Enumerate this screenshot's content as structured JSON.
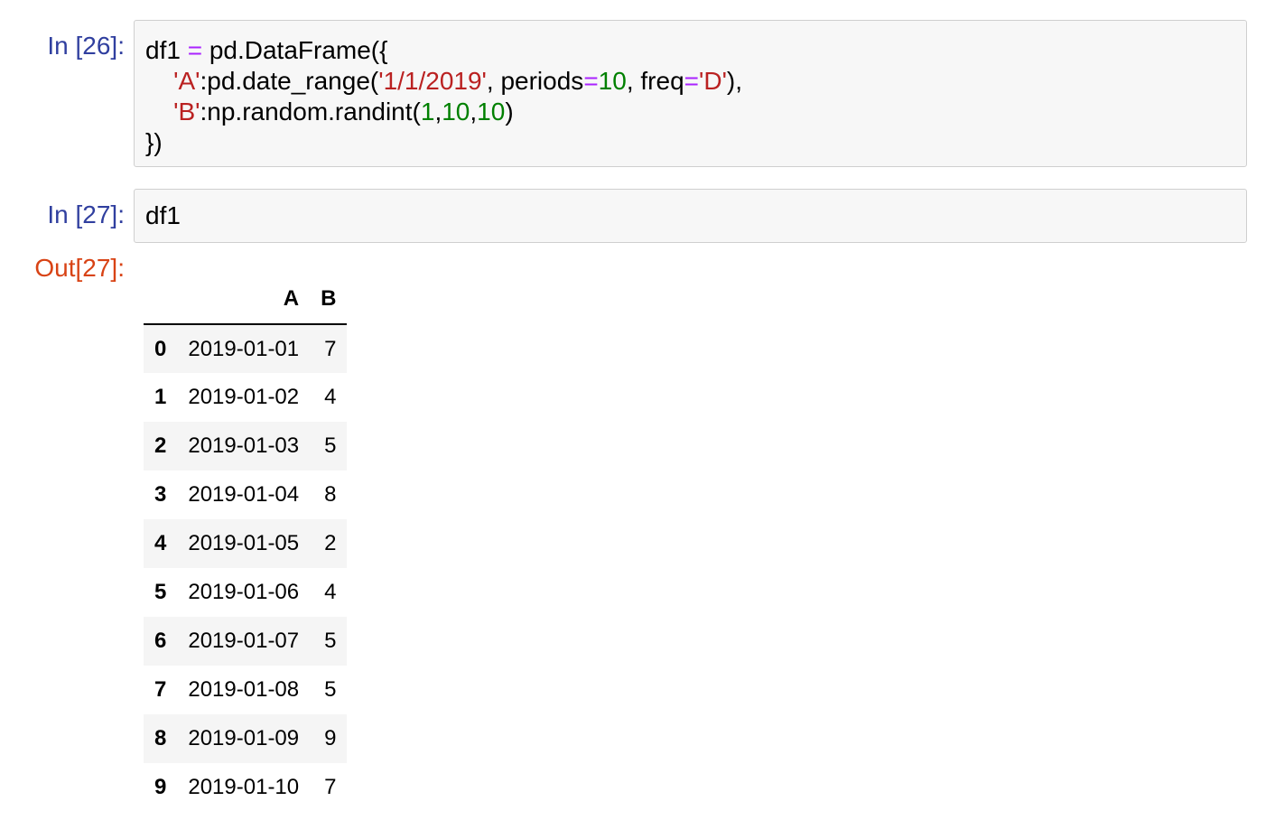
{
  "cells": {
    "cell26": {
      "prompt": "In [26]:",
      "code_lines": [
        [
          [
            "t",
            "df1 "
          ],
          [
            "o",
            "="
          ],
          [
            "t",
            " pd.DataFrame({"
          ]
        ],
        [
          [
            "t",
            "    "
          ],
          [
            "s",
            "'A'"
          ],
          [
            "t",
            ":pd.date_range("
          ],
          [
            "s",
            "'1/1/2019'"
          ],
          [
            "t",
            ", periods"
          ],
          [
            "o",
            "="
          ],
          [
            "n",
            "10"
          ],
          [
            "t",
            ", freq"
          ],
          [
            "o",
            "="
          ],
          [
            "s",
            "'D'"
          ],
          [
            "t",
            "),"
          ]
        ],
        [
          [
            "t",
            "    "
          ],
          [
            "s",
            "'B'"
          ],
          [
            "t",
            ":np.random.randint("
          ],
          [
            "n",
            "1"
          ],
          [
            "t",
            ","
          ],
          [
            "n",
            "10"
          ],
          [
            "t",
            ","
          ],
          [
            "n",
            "10"
          ],
          [
            "t",
            ")"
          ]
        ],
        [
          [
            "t",
            "})"
          ]
        ]
      ]
    },
    "cell27": {
      "prompt": "In [27]:",
      "code": "df1",
      "out_prompt": "Out[27]:"
    }
  },
  "dataframe": {
    "columns": [
      "A",
      "B"
    ],
    "rows": [
      {
        "index": "0",
        "A": "2019-01-01",
        "B": "7"
      },
      {
        "index": "1",
        "A": "2019-01-02",
        "B": "4"
      },
      {
        "index": "2",
        "A": "2019-01-03",
        "B": "5"
      },
      {
        "index": "3",
        "A": "2019-01-04",
        "B": "8"
      },
      {
        "index": "4",
        "A": "2019-01-05",
        "B": "2"
      },
      {
        "index": "5",
        "A": "2019-01-06",
        "B": "4"
      },
      {
        "index": "6",
        "A": "2019-01-07",
        "B": "5"
      },
      {
        "index": "7",
        "A": "2019-01-08",
        "B": "5"
      },
      {
        "index": "8",
        "A": "2019-01-09",
        "B": "9"
      },
      {
        "index": "9",
        "A": "2019-01-10",
        "B": "7"
      }
    ]
  },
  "colors": {
    "in_prompt": "#303f9f",
    "out_prompt": "#d84315",
    "string": "#ba2121",
    "number": "#008000",
    "operator": "#aa22ff",
    "cell_background": "#f7f7f7",
    "cell_border": "#cfcfcf"
  }
}
